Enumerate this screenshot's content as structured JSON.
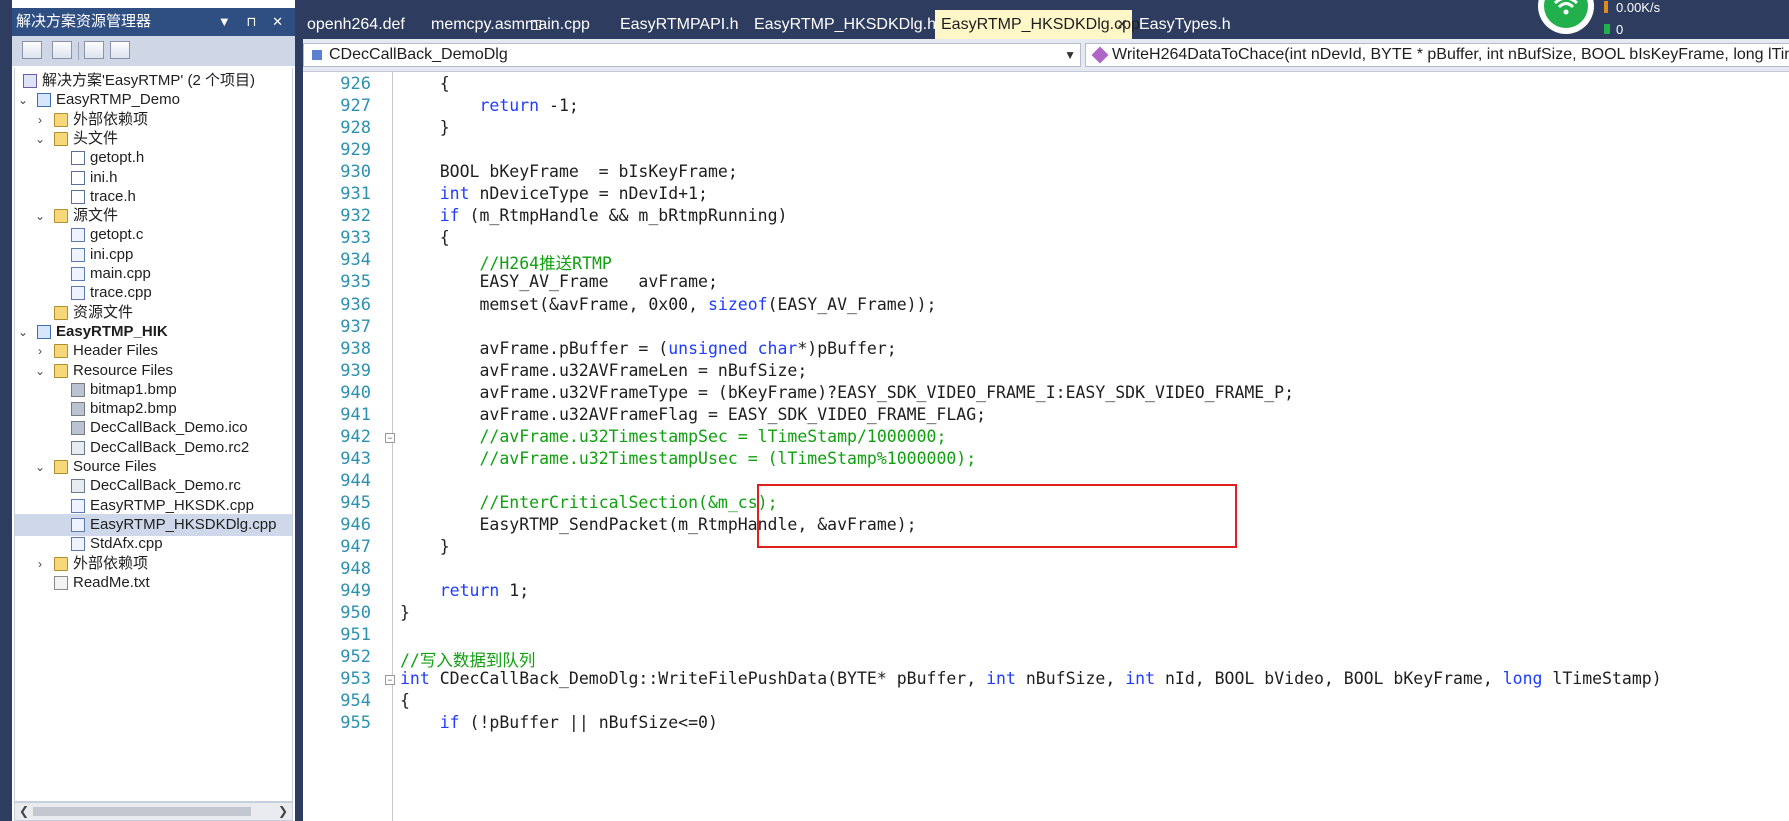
{
  "solution_explorer": {
    "title": "解决方案资源管理器",
    "title_buttons": "▼ ⊓ ✕",
    "tree": [
      {
        "label": "解决方案'EasyRTMP' (2 个项目)",
        "icon": "solution-icon",
        "level": 0,
        "arrow": ""
      },
      {
        "label": "EasyRTMP_Demo",
        "icon": "project-icon",
        "level": 0,
        "arrow": "v"
      },
      {
        "label": "外部依赖项",
        "icon": "folder-icon",
        "level": 1,
        "arrow": ">"
      },
      {
        "label": "头文件",
        "icon": "folder-icon",
        "level": 1,
        "arrow": "v"
      },
      {
        "label": "getopt.h",
        "icon": "header-file-icon",
        "level": 2,
        "arrow": ""
      },
      {
        "label": "ini.h",
        "icon": "header-file-icon",
        "level": 2,
        "arrow": ""
      },
      {
        "label": "trace.h",
        "icon": "header-file-icon",
        "level": 2,
        "arrow": ""
      },
      {
        "label": "源文件",
        "icon": "folder-icon",
        "level": 1,
        "arrow": "v"
      },
      {
        "label": "getopt.c",
        "icon": "cpp-file-icon",
        "level": 2,
        "arrow": ""
      },
      {
        "label": "ini.cpp",
        "icon": "cpp-file-icon",
        "level": 2,
        "arrow": ""
      },
      {
        "label": "main.cpp",
        "icon": "cpp-file-icon",
        "level": 2,
        "arrow": ""
      },
      {
        "label": "trace.cpp",
        "icon": "cpp-file-icon",
        "level": 2,
        "arrow": ""
      },
      {
        "label": "资源文件",
        "icon": "folder-icon",
        "level": 1,
        "arrow": ""
      },
      {
        "label": "EasyRTMP_HIK",
        "icon": "project-icon",
        "level": 0,
        "arrow": "v",
        "bold": true
      },
      {
        "label": "Header Files",
        "icon": "folder-icon",
        "level": 1,
        "arrow": ">"
      },
      {
        "label": "Resource Files",
        "icon": "folder-icon",
        "level": 1,
        "arrow": "v"
      },
      {
        "label": "bitmap1.bmp",
        "icon": "image-file-icon",
        "level": 2,
        "arrow": ""
      },
      {
        "label": "bitmap2.bmp",
        "icon": "image-file-icon",
        "level": 2,
        "arrow": ""
      },
      {
        "label": "DecCallBack_Demo.ico",
        "icon": "image-file-icon",
        "level": 2,
        "arrow": ""
      },
      {
        "label": "DecCallBack_Demo.rc2",
        "icon": "resource-file-icon",
        "level": 2,
        "arrow": ""
      },
      {
        "label": "Source Files",
        "icon": "folder-icon",
        "level": 1,
        "arrow": "v"
      },
      {
        "label": "DecCallBack_Demo.rc",
        "icon": "resource-file-icon",
        "level": 2,
        "arrow": ""
      },
      {
        "label": "EasyRTMP_HKSDK.cpp",
        "icon": "cpp-file-icon",
        "level": 2,
        "arrow": ""
      },
      {
        "label": "EasyRTMP_HKSDKDlg.cpp",
        "icon": "cpp-file-icon",
        "level": 2,
        "arrow": "",
        "selected": true
      },
      {
        "label": "StdAfx.cpp",
        "icon": "cpp-file-icon",
        "level": 2,
        "arrow": ""
      },
      {
        "label": "外部依赖项",
        "icon": "folder-icon",
        "level": 1,
        "arrow": ">"
      },
      {
        "label": "ReadMe.txt",
        "icon": "text-file-icon",
        "level": 1,
        "arrow": ""
      }
    ]
  },
  "tabs": [
    {
      "label": "openh264.def",
      "locked": false,
      "active": false
    },
    {
      "label": "memcpy.asm",
      "locked": true,
      "active": false
    },
    {
      "label": "main.cpp",
      "locked": false,
      "active": false
    },
    {
      "label": "EasyRTMPAPI.h",
      "locked": false,
      "active": false
    },
    {
      "label": "EasyRTMP_HKSDKDlg.h",
      "locked": false,
      "active": false
    },
    {
      "label": "EasyRTMP_HKSDKDlg.cpp",
      "locked": false,
      "active": true
    },
    {
      "label": "EasyTypes.h",
      "locked": false,
      "active": false
    }
  ],
  "active_tab_close": "✕",
  "network_widget": {
    "speed": "0.00K/s",
    "count": "0"
  },
  "navbar": {
    "class_selector": "CDecCallBack_DemoDlg",
    "method_selector": "WriteH264DataToChace(int nDevId, BYTE * pBuffer, int nBufSize, BOOL bIsKeyFrame, long lTim"
  },
  "editor": {
    "lines": [
      {
        "n": "926",
        "segs": [
          [
            "",
            "    {"
          ]
        ]
      },
      {
        "n": "927",
        "segs": [
          [
            "",
            "        "
          ],
          [
            "kw",
            "return"
          ],
          [
            "",
            " -1;"
          ]
        ]
      },
      {
        "n": "928",
        "segs": [
          [
            "",
            "    }"
          ]
        ]
      },
      {
        "n": "929",
        "segs": [
          [
            "",
            ""
          ]
        ]
      },
      {
        "n": "930",
        "segs": [
          [
            "",
            "    BOOL bKeyFrame  = bIsKeyFrame;"
          ]
        ]
      },
      {
        "n": "931",
        "segs": [
          [
            "",
            "    "
          ],
          [
            "kw",
            "int"
          ],
          [
            "",
            " nDeviceType = nDevId+1;"
          ]
        ]
      },
      {
        "n": "932",
        "segs": [
          [
            "",
            "    "
          ],
          [
            "kw",
            "if"
          ],
          [
            "",
            " (m_RtmpHandle && m_bRtmpRunning)"
          ]
        ]
      },
      {
        "n": "933",
        "segs": [
          [
            "",
            "    {"
          ]
        ]
      },
      {
        "n": "934",
        "segs": [
          [
            "",
            "        "
          ],
          [
            "cm",
            "//H264推送RTMP"
          ]
        ]
      },
      {
        "n": "935",
        "segs": [
          [
            "",
            "        EASY_AV_Frame   avFrame;"
          ]
        ]
      },
      {
        "n": "936",
        "segs": [
          [
            "",
            "        memset(&avFrame, 0x00, "
          ],
          [
            "kw",
            "sizeof"
          ],
          [
            "",
            "(EASY_AV_Frame));"
          ]
        ]
      },
      {
        "n": "937",
        "segs": [
          [
            "",
            ""
          ]
        ]
      },
      {
        "n": "938",
        "segs": [
          [
            "",
            "        avFrame.pBuffer = ("
          ],
          [
            "kw",
            "unsigned char"
          ],
          [
            "",
            "*)pBuffer;"
          ]
        ]
      },
      {
        "n": "939",
        "segs": [
          [
            "",
            "        avFrame.u32AVFrameLen = nBufSize;"
          ]
        ]
      },
      {
        "n": "940",
        "segs": [
          [
            "",
            "        avFrame.u32VFrameType = (bKeyFrame)?EASY_SDK_VIDEO_FRAME_I:EASY_SDK_VIDEO_FRAME_P;"
          ]
        ]
      },
      {
        "n": "941",
        "segs": [
          [
            "",
            "        avFrame.u32AVFrameFlag = EASY_SDK_VIDEO_FRAME_FLAG;"
          ]
        ]
      },
      {
        "n": "942",
        "segs": [
          [
            "",
            "        "
          ],
          [
            "cm",
            "//avFrame.u32TimestampSec = lTimeStamp/1000000;"
          ]
        ]
      },
      {
        "n": "943",
        "segs": [
          [
            "",
            "        "
          ],
          [
            "cm",
            "//avFrame.u32TimestampUsec = (lTimeStamp%1000000);"
          ]
        ]
      },
      {
        "n": "944",
        "segs": [
          [
            "",
            ""
          ]
        ]
      },
      {
        "n": "945",
        "segs": [
          [
            "",
            "        "
          ],
          [
            "cm",
            "//EnterCriticalSection(&m_cs);"
          ]
        ]
      },
      {
        "n": "946",
        "segs": [
          [
            "",
            "        EasyRTMP_SendPacket(m_RtmpHandle, &avFrame);"
          ]
        ]
      },
      {
        "n": "947",
        "segs": [
          [
            "",
            "    }"
          ]
        ]
      },
      {
        "n": "948",
        "segs": [
          [
            "",
            ""
          ]
        ]
      },
      {
        "n": "949",
        "segs": [
          [
            "",
            "    "
          ],
          [
            "kw",
            "return"
          ],
          [
            "",
            " 1;"
          ]
        ]
      },
      {
        "n": "950",
        "segs": [
          [
            "",
            "}"
          ]
        ]
      },
      {
        "n": "951",
        "segs": [
          [
            "",
            ""
          ]
        ]
      },
      {
        "n": "952",
        "segs": [
          [
            "cm",
            "//写入数据到队列"
          ]
        ]
      },
      {
        "n": "953",
        "segs": [
          [
            "kw",
            "int"
          ],
          [
            "",
            " CDecCallBack_DemoDlg::WriteFilePushData(BYTE* pBuffer, "
          ],
          [
            "kw",
            "int"
          ],
          [
            "",
            " nBufSize, "
          ],
          [
            "kw",
            "int"
          ],
          [
            "",
            " nId, BOOL bVideo, BOOL bKeyFrame, "
          ],
          [
            "kw",
            "long"
          ],
          [
            "",
            " lTimeStamp)"
          ]
        ]
      },
      {
        "n": "954",
        "segs": [
          [
            "",
            "{"
          ]
        ]
      },
      {
        "n": "955",
        "segs": [
          [
            "",
            "    "
          ],
          [
            "kw",
            "if"
          ],
          [
            "",
            " (!pBuffer || nBufSize<=0)"
          ]
        ]
      }
    ]
  }
}
